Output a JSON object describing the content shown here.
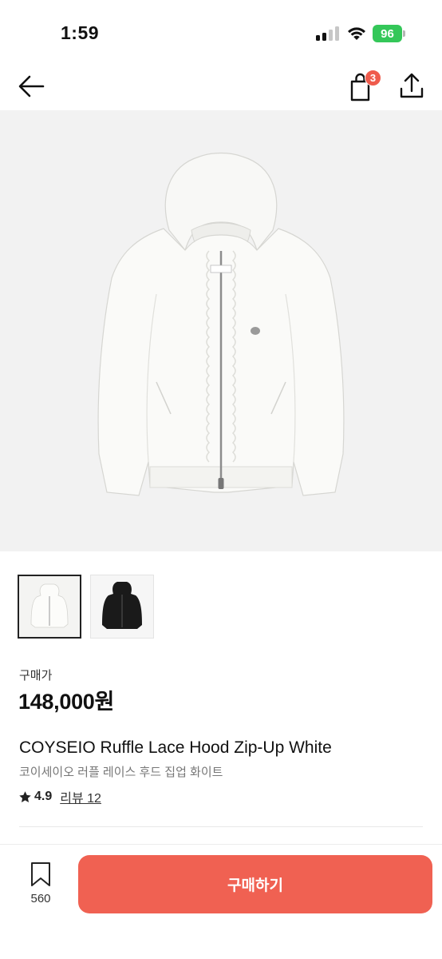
{
  "status_bar": {
    "time": "1:59",
    "battery": "96"
  },
  "header": {
    "cart_badge": "3",
    "icons": [
      "back-arrow-icon",
      "shopping-bag-icon",
      "share-icon"
    ]
  },
  "product": {
    "price_label": "구매가",
    "price": "148,000원",
    "name_en": "COYSEIO Ruffle Lace Hood Zip-Up White",
    "name_ko": "코이세이오 러플 레이스 후드 집업 화이트",
    "rating": "4.9",
    "review_label": "리뷰 12",
    "thumbnails": [
      {
        "color": "white",
        "selected": true
      },
      {
        "color": "black",
        "selected": false
      }
    ]
  },
  "bottom_bar": {
    "bookmark_count": "560",
    "buy_label": "구매하기"
  },
  "colors": {
    "accent": "#f06152",
    "badge": "#ef5b4c",
    "battery": "#34c759"
  }
}
